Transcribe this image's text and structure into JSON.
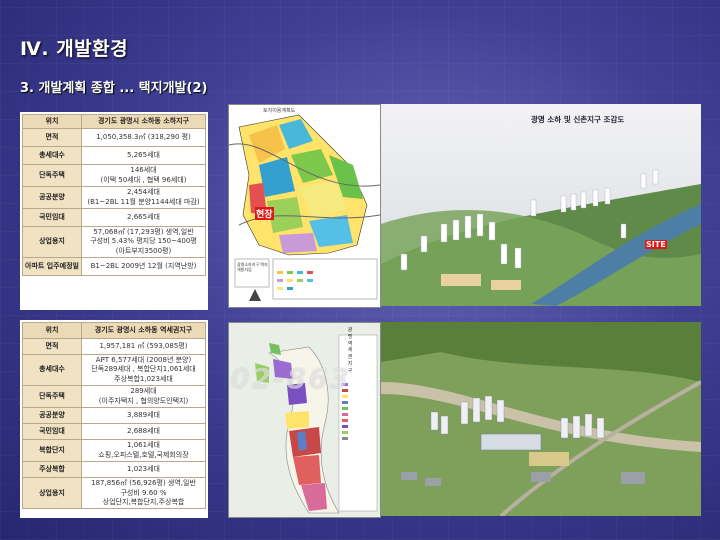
{
  "slide": {
    "title": "Ⅳ. 개발환경",
    "subtitle": "3. 개발계획 종합 ... 택지개발(2)"
  },
  "table1": {
    "header": [
      "위치",
      "경기도 광명시 소하동 소하지구"
    ],
    "rows": [
      {
        "label": "면적",
        "lines": [
          "1,050,358.3㎡ (318,290 평)"
        ]
      },
      {
        "label": "총세대수",
        "lines": [
          "5,265세대"
        ]
      },
      {
        "label": "단독주택",
        "lines": [
          "146세대",
          "(이택 50세대 , 협택 96세대)"
        ]
      },
      {
        "label": "공공분양",
        "lines": [
          "2,454세대",
          "(B1~2BL 11월 분양1144세대 마감)"
        ]
      },
      {
        "label": "국민임대",
        "lines": [
          "2,665세대"
        ]
      },
      {
        "label": "상업용지",
        "lines": [
          "57,068㎡ (17,293평) 생역,일반",
          "구성비 5.43% 평지당 150~400평",
          "(아트부지3500평)"
        ]
      },
      {
        "label": "아파트 입주예정일",
        "lines": [
          "B1~2BL 2009년 12월 (지역난방)"
        ]
      }
    ]
  },
  "table2": {
    "header": [
      "위치",
      "경기도 광명시 소하동 역세권지구"
    ],
    "rows": [
      {
        "label": "면적",
        "lines": [
          "1,957,181 ㎡ (593,085평)"
        ]
      },
      {
        "label": "총세대수",
        "lines": [
          "APT 6,577세대 (2008년 분양)",
          "단독289세대 , 복합단지1,061세대",
          "주상복합1,023세대"
        ]
      },
      {
        "label": "단독주택",
        "lines": [
          "289세대",
          "(이주자택지 , 협의양도인택지)"
        ]
      },
      {
        "label": "공공분양",
        "lines": [
          "3,889세대"
        ]
      },
      {
        "label": "국민임대",
        "lines": [
          "2,688세대"
        ]
      },
      {
        "label": "복합단지",
        "lines": [
          "1,061세대",
          "쇼핑,오피스텔,호텔,국제회의장"
        ]
      },
      {
        "label": "주상복합",
        "lines": [
          "1,023세대"
        ]
      },
      {
        "label": "상업용지",
        "lines": [
          "187,856㎡ (56,926평) 생역,일반",
          "구성비 9.60 %",
          "상업단지,복합단지,주상복합"
        ]
      }
    ]
  },
  "map1": {
    "caption": "토지이용계획도",
    "site_label": "현장",
    "legend_title": "광명소하지구 택지개발사업"
  },
  "photo1": {
    "caption": "광명 소하 및 신촌지구 조감도",
    "site_label": "SITE"
  },
  "map2": {
    "side_text": [
      "광",
      "명",
      "역",
      "세",
      "권",
      "지",
      "구"
    ]
  },
  "watermark": {
    "text": "02-863"
  }
}
